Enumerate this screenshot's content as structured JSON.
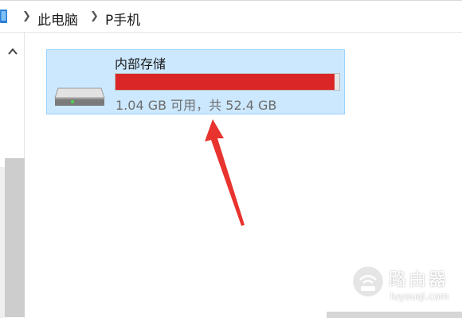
{
  "breadcrumb": {
    "items": [
      "此电脑",
      "P手机"
    ],
    "separator": ">"
  },
  "drive": {
    "name": "内部存储",
    "free_text": "1.04 GB 可用，共 52.4 GB",
    "used_fraction": 0.98,
    "bar_color": "#da2626"
  },
  "watermark": {
    "title": "路由器",
    "subtitle": "luyouqi.com"
  },
  "colors": {
    "selection_bg": "#cce8ff",
    "selection_border": "#99d1ff",
    "arrow": "#e8332e"
  },
  "icons": [
    "this-pc-icon",
    "chevron-right-icon",
    "scroll-up-arrow-icon",
    "drive-icon",
    "annotation-arrow-icon",
    "router-logo-icon"
  ]
}
